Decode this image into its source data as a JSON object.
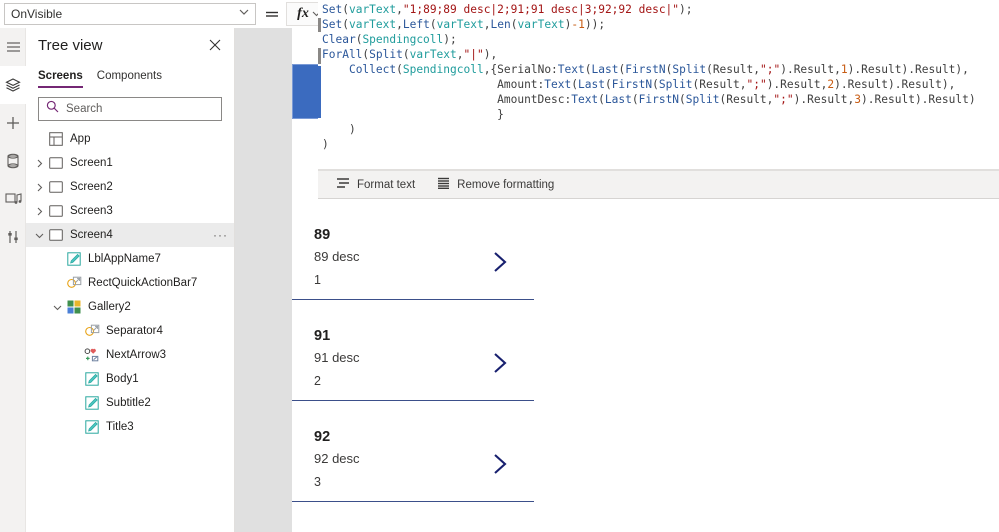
{
  "propertybar": {
    "property_name": "OnVisible",
    "equals_label": "=",
    "fx_label": "fx",
    "caret_glyph": "⌄"
  },
  "formula": {
    "lines": [
      "Set(varText,\"1;89;89 desc|2;91;91 desc|3;92;92 desc|\");",
      "Set(varText,Left(varText,Len(varText)-1));",
      "Clear(Spendingcoll);",
      "ForAll(Split(varText,\"|\"),",
      "    Collect(Spendingcoll,{SerialNo:Text(Last(FirstN(Split(Result,\";\").Result,1).Result).Result),",
      "                          Amount:Text(Last(FirstN(Split(Result,\";\").Result,2).Result).Result),",
      "                          AmountDesc:Text(Last(FirstN(Split(Result,\";\").Result,3).Result).Result)",
      "                          }",
      "    )",
      ")"
    ]
  },
  "formula_toolbar": {
    "format_text_label": "Format text",
    "remove_formatting_label": "Remove formatting"
  },
  "rail": {
    "items": [
      {
        "name": "hamburger-menu-icon",
        "active": false
      },
      {
        "name": "tree-view-icon",
        "active": true
      },
      {
        "name": "insert-add-icon",
        "active": false
      },
      {
        "name": "data-sources-icon",
        "active": false
      },
      {
        "name": "media-icon",
        "active": false
      },
      {
        "name": "advanced-settings-icon",
        "active": false
      }
    ]
  },
  "treeview": {
    "title": "Tree view",
    "close_glyph": "✕",
    "tabs": [
      {
        "label": "Screens",
        "active": true
      },
      {
        "label": "Components",
        "active": false
      }
    ],
    "search_placeholder": "Search",
    "nodes": [
      {
        "label": "App",
        "indent": 0,
        "chevron": "",
        "icon": "app-icon",
        "selected": false,
        "more": false
      },
      {
        "label": "Screen1",
        "indent": 0,
        "chevron": "›",
        "icon": "screen-icon",
        "selected": false,
        "more": false
      },
      {
        "label": "Screen2",
        "indent": 0,
        "chevron": "›",
        "icon": "screen-icon",
        "selected": false,
        "more": false
      },
      {
        "label": "Screen3",
        "indent": 0,
        "chevron": "›",
        "icon": "screen-icon",
        "selected": false,
        "more": false
      },
      {
        "label": "Screen4",
        "indent": 0,
        "chevron": "⌄",
        "icon": "screen-icon",
        "selected": true,
        "more": true
      },
      {
        "label": "LblAppName7",
        "indent": 1,
        "chevron": "",
        "icon": "label-icon",
        "selected": false,
        "more": false
      },
      {
        "label": "RectQuickActionBar7",
        "indent": 1,
        "chevron": "",
        "icon": "shape-icon",
        "selected": false,
        "more": false
      },
      {
        "label": "Gallery2",
        "indent": 1,
        "chevron": "⌄",
        "icon": "gallery-icon",
        "selected": false,
        "more": false
      },
      {
        "label": "Separator4",
        "indent": 2,
        "chevron": "",
        "icon": "shape-icon",
        "selected": false,
        "more": false
      },
      {
        "label": "NextArrow3",
        "indent": 2,
        "chevron": "",
        "icon": "icon-control-icon",
        "selected": false,
        "more": false
      },
      {
        "label": "Body1",
        "indent": 2,
        "chevron": "",
        "icon": "label-icon",
        "selected": false,
        "more": false
      },
      {
        "label": "Subtitle2",
        "indent": 2,
        "chevron": "",
        "icon": "label-icon",
        "selected": false,
        "more": false
      },
      {
        "label": "Title3",
        "indent": 2,
        "chevron": "",
        "icon": "label-icon",
        "selected": false,
        "more": false
      }
    ],
    "more_glyph": "···"
  },
  "canvas": {
    "gallery_items": [
      {
        "title": "89",
        "subtitle": "89 desc",
        "body": "1"
      },
      {
        "title": "91",
        "subtitle": "91 desc",
        "body": "2"
      },
      {
        "title": "92",
        "subtitle": "92 desc",
        "body": "3"
      }
    ],
    "arrow_glyph": "›"
  },
  "colors": {
    "accent_purple": "#742774",
    "selection_blue": "#3b6bbf",
    "separator_blue": "#3b4f8a",
    "code_function": "#2b579a",
    "code_variable": "#1f9c9c",
    "code_string": "#a31515",
    "code_number": "#c75b12",
    "panel_gray": "#f3f2f1",
    "canvas_gray": "#e0e0e0"
  }
}
